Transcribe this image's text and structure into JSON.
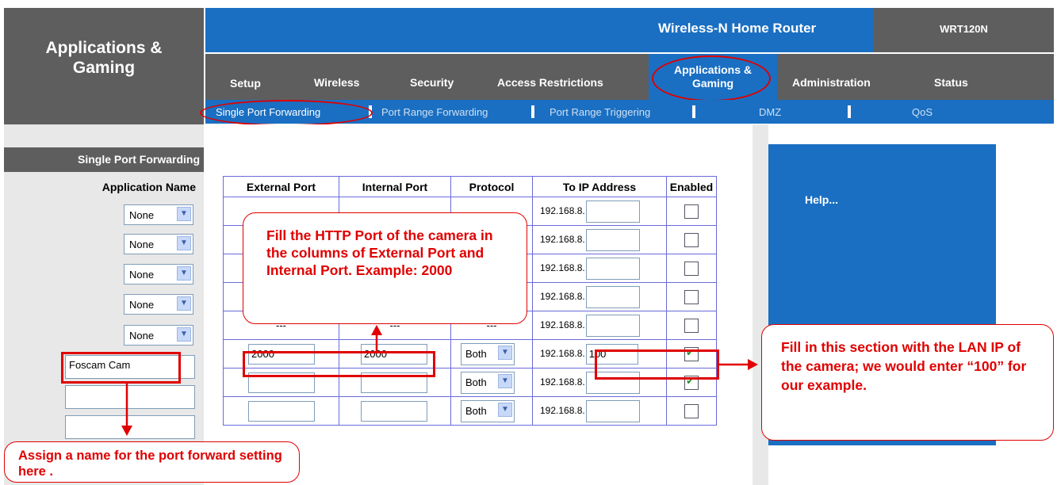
{
  "header": {
    "section_title": "Applications &\nGaming",
    "product_name": "Wireless-N Home Router",
    "model": "WRT120N"
  },
  "tabs": [
    {
      "label": "Setup"
    },
    {
      "label": "Wireless"
    },
    {
      "label": "Security"
    },
    {
      "label": "Access Restrictions"
    },
    {
      "label": "Applications &\nGaming",
      "active": true
    },
    {
      "label": "Administration"
    },
    {
      "label": "Status"
    }
  ],
  "subtabs": [
    {
      "label": "Single Port Forwarding",
      "active": true
    },
    {
      "label": "Port Range Forwarding"
    },
    {
      "label": "Port Range Triggering"
    },
    {
      "label": "DMZ"
    },
    {
      "label": "QoS"
    }
  ],
  "left": {
    "subhead": "Single Port Forwarding",
    "app_name_header": "Application Name",
    "app_rows": [
      "None",
      "None",
      "None",
      "None",
      "None",
      "Foscam Cam",
      "",
      ""
    ]
  },
  "table": {
    "headers": [
      "External Port",
      "Internal Port",
      "Protocol",
      "To IP Address",
      "Enabled"
    ],
    "ip_prefix": "192.168.8.",
    "rows": [
      {
        "external": "",
        "internal": "",
        "protocol": "",
        "ip": "",
        "enabled": false
      },
      {
        "external": "",
        "internal": "",
        "protocol": "",
        "ip": "",
        "enabled": false
      },
      {
        "external": "",
        "internal": "",
        "protocol": "",
        "ip": "",
        "enabled": false
      },
      {
        "external": "",
        "internal": "",
        "protocol": "",
        "ip": "",
        "enabled": false
      },
      {
        "external": "---",
        "internal": "---",
        "protocol": "---",
        "ip": "",
        "enabled": false
      },
      {
        "external": "2000",
        "internal": "2000",
        "protocol": "Both",
        "ip": "100",
        "enabled": true
      },
      {
        "external": "",
        "internal": "",
        "protocol": "Both",
        "ip": "",
        "enabled": true
      },
      {
        "external": "",
        "internal": "",
        "protocol": "Both",
        "ip": "",
        "enabled": false
      }
    ]
  },
  "help": {
    "label": "Help..."
  },
  "callouts": {
    "http_port": "Fill the HTTP Port of the camera in the columns of External Port and Internal Port. Example: 2000",
    "lan_ip": "Fill in this section with the LAN IP of the camera; we would enter “100” for our example.",
    "name": "Assign a name for the port forward setting here ."
  },
  "colors": {
    "accent_blue": "#1a6fc2",
    "header_gray": "#5e5e5e",
    "annotation_red": "#e00000"
  }
}
